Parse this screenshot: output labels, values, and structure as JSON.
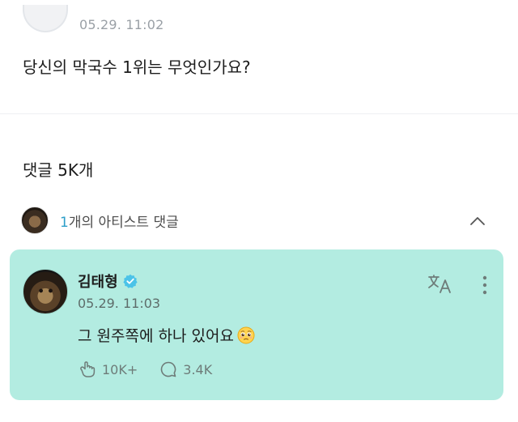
{
  "post": {
    "date": "05.29. 11:02",
    "text": "당신의 막국수 1위는 무엇인가요?"
  },
  "comments": {
    "title": "댓글 5K개"
  },
  "artist_section": {
    "count": "1",
    "label": "개의 아티스트 댓글"
  },
  "artist_comment": {
    "name": "김태형",
    "date": "05.29. 11:03",
    "text": "그 원주쪽에 하나 있어요",
    "likes": "10K+",
    "replies": "3.4K"
  },
  "colors": {
    "card_background": "#b3ece1",
    "verified_badge": "#4bc3e8",
    "artist_count": "#2e9fc9"
  },
  "icons": [
    "verified-badge-icon",
    "translate-icon",
    "more-vertical-icon",
    "chevron-up-icon",
    "like-hand-icon",
    "reply-bubble-icon",
    "pleading-face-emoji"
  ]
}
